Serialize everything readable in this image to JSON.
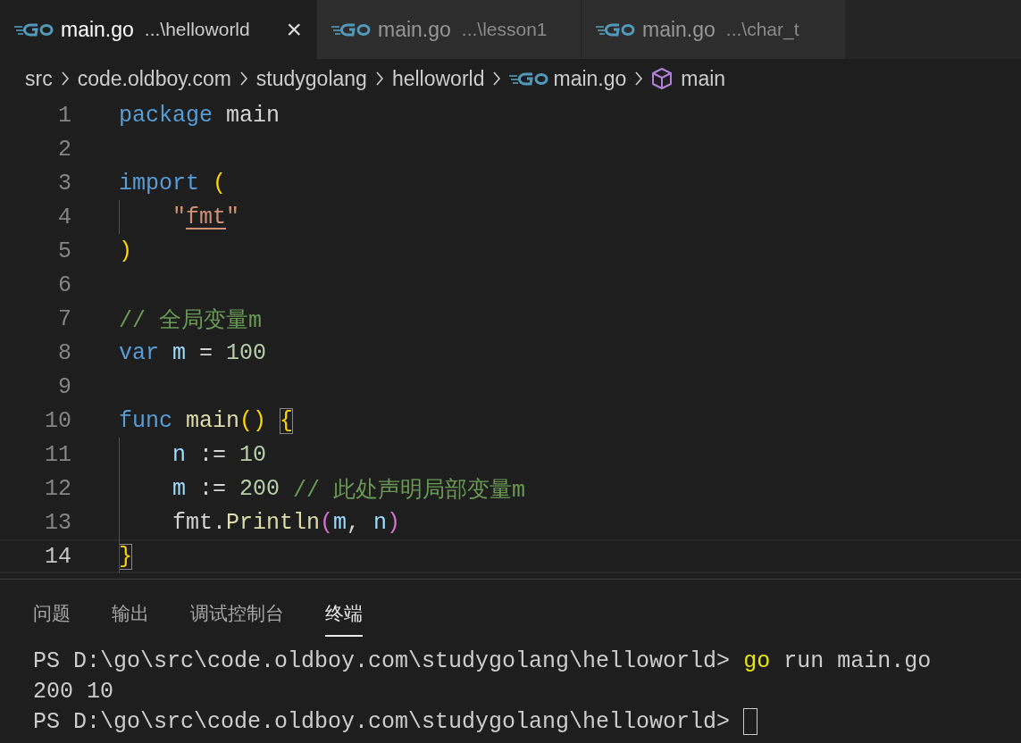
{
  "tabs": [
    {
      "label": "main.go",
      "path": "...\\helloworld",
      "selected": true,
      "close": "×"
    },
    {
      "label": "main.go",
      "path": "...\\lesson1",
      "selected": false
    },
    {
      "label": "main.go",
      "path": "...\\char_t",
      "selected": false
    }
  ],
  "breadcrumbs": [
    {
      "kind": "folder",
      "label": "src"
    },
    {
      "kind": "folder",
      "label": "code.oldboy.com"
    },
    {
      "kind": "folder",
      "label": "studygolang"
    },
    {
      "kind": "folder",
      "label": "helloworld"
    },
    {
      "kind": "file",
      "label": "main.go"
    },
    {
      "kind": "symbol",
      "label": "main"
    }
  ],
  "editor": {
    "lines": [
      {
        "number": "1",
        "current": false,
        "guide": false,
        "indented": false,
        "tokens": [
          {
            "kind": "keyword",
            "text": "package"
          },
          {
            "kind": "plain",
            "text": " main"
          }
        ]
      },
      {
        "number": "2",
        "current": false,
        "guide": false
      },
      {
        "number": "3",
        "current": false,
        "guide": false,
        "indented": false,
        "tokens": [
          {
            "kind": "keyword",
            "text": "import "
          },
          {
            "kind": "bracket",
            "text": "("
          }
        ]
      },
      {
        "number": "4",
        "current": false,
        "guide": true,
        "indented": true,
        "tokens": [
          {
            "kind": "string",
            "text": "\""
          },
          {
            "kind": "string",
            "text": "fmt",
            "underline": true
          },
          {
            "kind": "string",
            "text": "\""
          }
        ]
      },
      {
        "number": "5",
        "current": false,
        "guide": false,
        "indented": false,
        "tokens": [
          {
            "kind": "bracket",
            "text": ")"
          }
        ]
      },
      {
        "number": "6",
        "current": false,
        "guide": false
      },
      {
        "number": "7",
        "current": false,
        "guide": false,
        "indented": false,
        "tokens": [
          {
            "kind": "comment",
            "text": "// 全局变量m"
          }
        ]
      },
      {
        "number": "8",
        "current": false,
        "guide": false,
        "indented": false,
        "tokens": [
          {
            "kind": "keyword",
            "text": "var "
          },
          {
            "kind": "variable",
            "text": "m"
          },
          {
            "kind": "plain",
            "text": " = "
          },
          {
            "kind": "number",
            "text": "100"
          }
        ]
      },
      {
        "number": "9",
        "current": false,
        "guide": false
      },
      {
        "number": "10",
        "current": false,
        "guide": false,
        "indented": false,
        "tokens": [
          {
            "kind": "keyword",
            "text": "func "
          },
          {
            "kind": "function",
            "text": "main"
          },
          {
            "kind": "bracket",
            "text": "() "
          },
          {
            "kind": "bracket",
            "text": "{",
            "matched": true
          }
        ]
      },
      {
        "number": "11",
        "current": false,
        "guide": true,
        "indented": true,
        "tokens": [
          {
            "kind": "variable",
            "text": "n"
          },
          {
            "kind": "plain",
            "text": " := "
          },
          {
            "kind": "number",
            "text": "10"
          }
        ]
      },
      {
        "number": "12",
        "current": false,
        "guide": true,
        "indented": true,
        "tokens": [
          {
            "kind": "variable",
            "text": "m"
          },
          {
            "kind": "plain",
            "text": " := "
          },
          {
            "kind": "number",
            "text": "200 "
          },
          {
            "kind": "comment",
            "text": "// 此处声明局部变量m"
          }
        ]
      },
      {
        "number": "13",
        "current": false,
        "guide": true,
        "indented": true,
        "tokens": [
          {
            "kind": "plain",
            "text": "fmt."
          },
          {
            "kind": "function",
            "text": "Println"
          },
          {
            "kind": "bracket2",
            "text": "("
          },
          {
            "kind": "variable",
            "text": "m"
          },
          {
            "kind": "plain",
            "text": ", "
          },
          {
            "kind": "variable",
            "text": "n"
          },
          {
            "kind": "bracket2",
            "text": ")"
          }
        ]
      },
      {
        "number": "14",
        "current": true,
        "guide": true,
        "indented": false,
        "tokens": [
          {
            "kind": "bracket",
            "text": "}",
            "matched": true
          }
        ]
      }
    ]
  },
  "panel": {
    "tabs": [
      {
        "label": "问题",
        "selected": false
      },
      {
        "label": "输出",
        "selected": false
      },
      {
        "label": "调试控制台",
        "selected": false
      },
      {
        "label": "终端",
        "selected": true
      }
    ],
    "terminal": [
      {
        "segments": [
          {
            "kind": "prompt",
            "text": "PS D:\\go\\src\\code.oldboy.com\\studygolang\\helloworld> "
          },
          {
            "kind": "command",
            "text": "go"
          },
          {
            "kind": "plain",
            "text": " run main.go"
          }
        ],
        "cursor": false
      },
      {
        "segments": [
          {
            "kind": "plain",
            "text": "200 10"
          }
        ],
        "cursor": false
      },
      {
        "segments": [
          {
            "kind": "prompt",
            "text": "PS D:\\go\\src\\code.oldboy.com\\studygolang\\helloworld> "
          }
        ],
        "cursor": true
      }
    ]
  }
}
